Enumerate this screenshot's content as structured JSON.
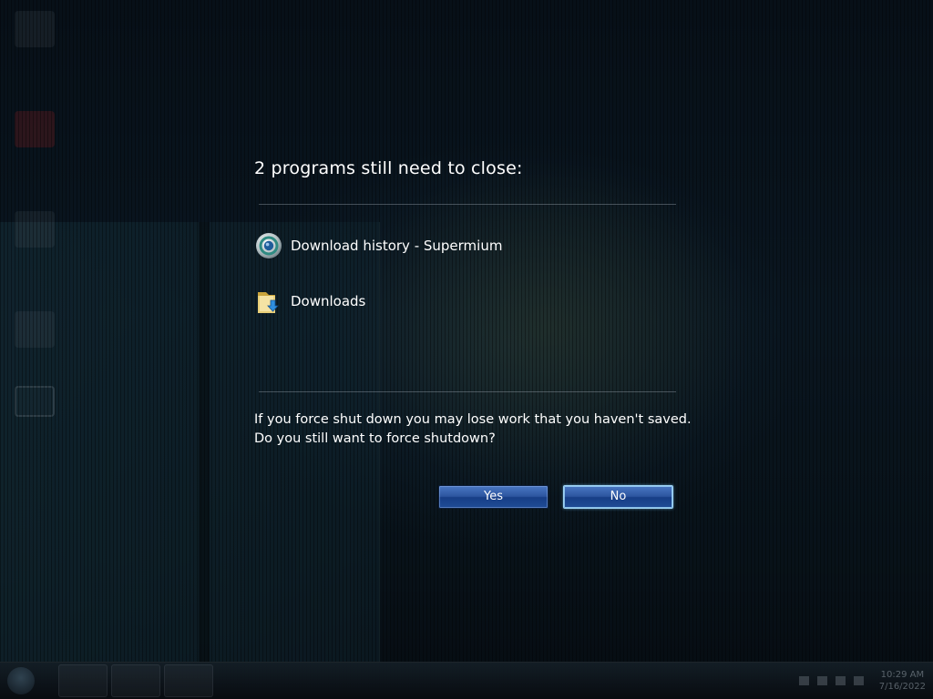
{
  "dialog": {
    "title": "2 programs still need to close:",
    "programs": [
      {
        "name": "Download history - Supermium",
        "icon": "supermium-browser-icon"
      },
      {
        "name": "Downloads",
        "icon": "folder-download-icon"
      }
    ],
    "message_line1": "If you force shut down you may lose work that you haven't saved.",
    "message_line2": "Do you still want to force shutdown?",
    "yes_label": "Yes",
    "no_label": "No"
  },
  "taskbar": {
    "clock_time": "10:29 AM",
    "clock_date": "7/16/2022"
  },
  "colors": {
    "button_blue": "#2c559f",
    "focus_glow": "#9fd4f5",
    "background": "#05090e"
  }
}
